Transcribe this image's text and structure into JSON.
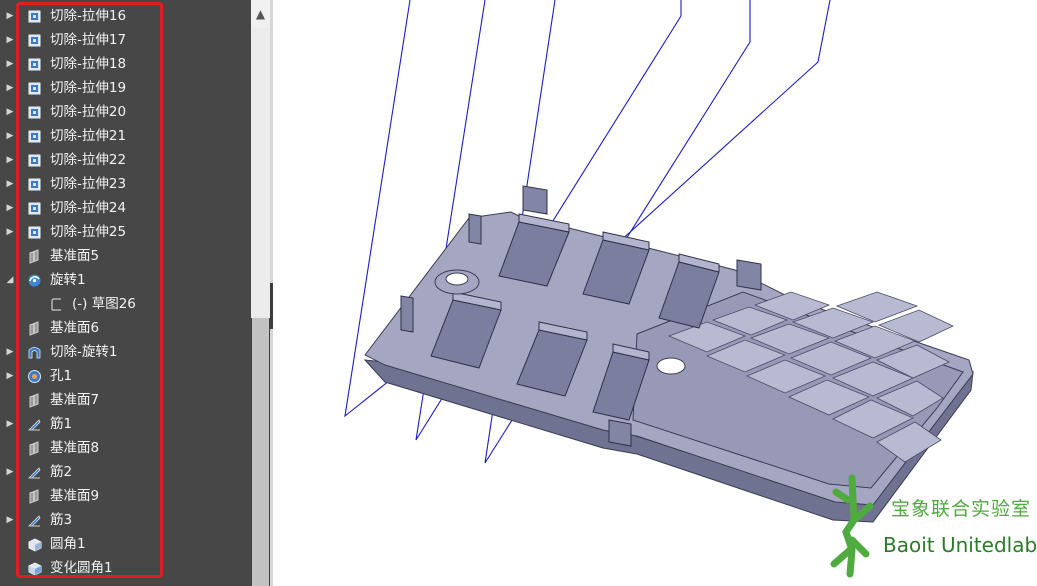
{
  "feature_tree": {
    "items": [
      {
        "label": "切除-拉伸16",
        "icon": "cut-extrude-icon",
        "expandable": true
      },
      {
        "label": "切除-拉伸17",
        "icon": "cut-extrude-icon",
        "expandable": true
      },
      {
        "label": "切除-拉伸18",
        "icon": "cut-extrude-icon",
        "expandable": true
      },
      {
        "label": "切除-拉伸19",
        "icon": "cut-extrude-icon",
        "expandable": true
      },
      {
        "label": "切除-拉伸20",
        "icon": "cut-extrude-icon",
        "expandable": true
      },
      {
        "label": "切除-拉伸21",
        "icon": "cut-extrude-icon",
        "expandable": true
      },
      {
        "label": "切除-拉伸22",
        "icon": "cut-extrude-icon",
        "expandable": true
      },
      {
        "label": "切除-拉伸23",
        "icon": "cut-extrude-icon",
        "expandable": true
      },
      {
        "label": "切除-拉伸24",
        "icon": "cut-extrude-icon",
        "expandable": true
      },
      {
        "label": "切除-拉伸25",
        "icon": "cut-extrude-icon",
        "expandable": true
      },
      {
        "label": "基准面5",
        "icon": "plane-icon",
        "expandable": false
      },
      {
        "label": "旋转1",
        "icon": "revolve-icon",
        "expandable": true,
        "expanded": true
      },
      {
        "label": "(-) 草图26",
        "icon": "sketch-icon",
        "expandable": false,
        "indent": 1
      },
      {
        "label": "基准面6",
        "icon": "plane-icon",
        "expandable": false
      },
      {
        "label": "切除-旋转1",
        "icon": "cut-revolve-icon",
        "expandable": true
      },
      {
        "label": "孔1",
        "icon": "hole-icon",
        "expandable": true
      },
      {
        "label": "基准面7",
        "icon": "plane-icon",
        "expandable": false
      },
      {
        "label": "筋1",
        "icon": "rib-icon",
        "expandable": true
      },
      {
        "label": "基准面8",
        "icon": "plane-icon",
        "expandable": false
      },
      {
        "label": "筋2",
        "icon": "rib-icon",
        "expandable": true
      },
      {
        "label": "基准面9",
        "icon": "plane-icon",
        "expandable": false
      },
      {
        "label": "筋3",
        "icon": "rib-icon",
        "expandable": true
      },
      {
        "label": "圆角1",
        "icon": "fillet-icon",
        "expandable": false
      },
      {
        "label": "变化圆角1",
        "icon": "variable-fillet-icon",
        "expandable": false
      }
    ]
  },
  "colors": {
    "panel_bg": "#474747",
    "highlight_border": "#e31d1d",
    "model_face": "#9a9cb8",
    "wireframe_line": "#1d1dc8",
    "watermark_green": "#4faa3f"
  },
  "watermark": {
    "cn_text": "宝象联合实验室",
    "en_text": "Baoit Unitedlabs",
    "logo_icon": "baoit-logo-icon"
  }
}
